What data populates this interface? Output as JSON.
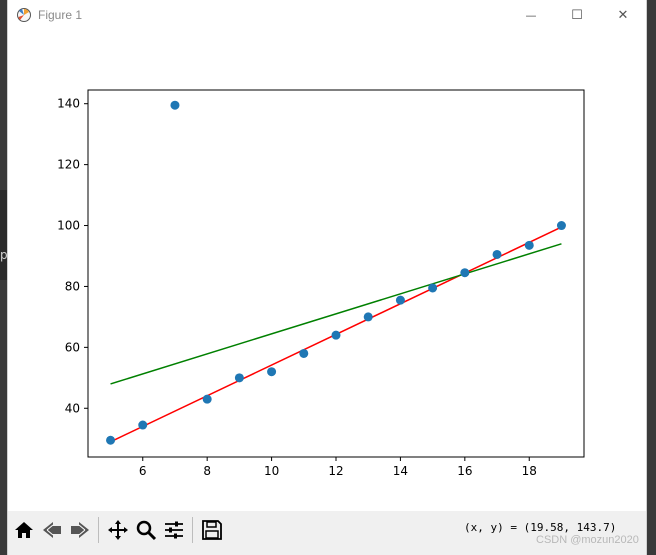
{
  "window": {
    "title": "Figure 1",
    "minimize_symbol": "—",
    "maximize_symbol": "☐",
    "close_symbol": "✕"
  },
  "background": {
    "left_fragment": "p"
  },
  "toolbar": {
    "coords_text": "(x, y) = (19.58, 143.7)",
    "watermark": "CSDN @mozun2020",
    "buttons": [
      {
        "name": "home-icon"
      },
      {
        "name": "back-icon"
      },
      {
        "name": "forward-icon"
      },
      {
        "name": "pan-icon"
      },
      {
        "name": "zoom-icon"
      },
      {
        "name": "configure-subplots-icon"
      },
      {
        "name": "save-icon"
      }
    ]
  },
  "chart_data": {
    "type": "scatter",
    "title": "",
    "xlabel": "",
    "ylabel": "",
    "xlim": [
      4.3,
      19.7
    ],
    "ylim": [
      24,
      144.5
    ],
    "xticks": [
      6,
      8,
      10,
      12,
      14,
      16,
      18
    ],
    "yticks": [
      40,
      60,
      80,
      100,
      120,
      140
    ],
    "grid": false,
    "colors": {
      "points": "#1f77b4",
      "fit_line": "#ff0000",
      "robust_line": "#008000"
    },
    "series": [
      {
        "kind": "scatter",
        "x": [
          5,
          6,
          7,
          8,
          9,
          10,
          11,
          12,
          13,
          14,
          15,
          16,
          17,
          18,
          19
        ],
        "y": [
          29.5,
          34.5,
          139.5,
          43,
          50,
          52,
          58,
          64,
          70,
          75.5,
          79.5,
          84.5,
          90.5,
          93.5,
          100
        ]
      },
      {
        "kind": "line",
        "x": [
          5,
          19
        ],
        "y": [
          29,
          99.5
        ],
        "color": "#ff0000"
      },
      {
        "kind": "line",
        "x": [
          5,
          19
        ],
        "y": [
          48,
          94
        ],
        "color": "#008000"
      }
    ]
  }
}
